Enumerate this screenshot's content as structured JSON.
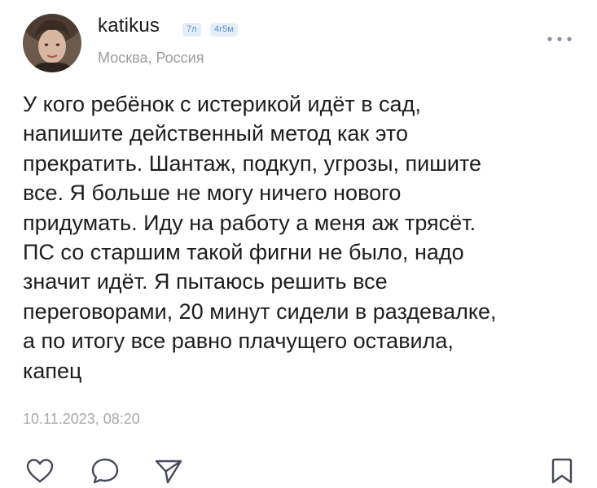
{
  "post": {
    "author": {
      "username": "katikus",
      "badges": [
        "7л",
        "4г5м"
      ],
      "location": "Москва, Россия"
    },
    "text_lines": [
      "У кого ребёнок с истерикой идёт в сад,",
      "напишите действенный метод как это",
      "прекратить. Шантаж, подкуп, угрозы, пишите",
      "все. Я больше не могу ничего нового",
      "придумать. Иду на работу а меня аж трясёт.",
      "ПС со старшим такой фигни не было, надо",
      "значит идёт. Я пытаюсь решить все",
      "переговорами, 20 минут сидели в раздевалке,",
      "а по итогу все равно плачущего оставила,",
      "капец"
    ],
    "timestamp": "10.11.2023, 08:20"
  },
  "icons": {
    "more": "more-dots-icon",
    "like": "heart-icon",
    "comment": "comment-bubble-icon",
    "share": "share-paper-plane-icon",
    "bookmark": "bookmark-icon"
  },
  "colors": {
    "text": "#1e1e1e",
    "secondary": "#9b9b9b",
    "icon": "#444a5a",
    "badge_bg": "#e3eef8",
    "badge_text": "#5f94c4"
  }
}
